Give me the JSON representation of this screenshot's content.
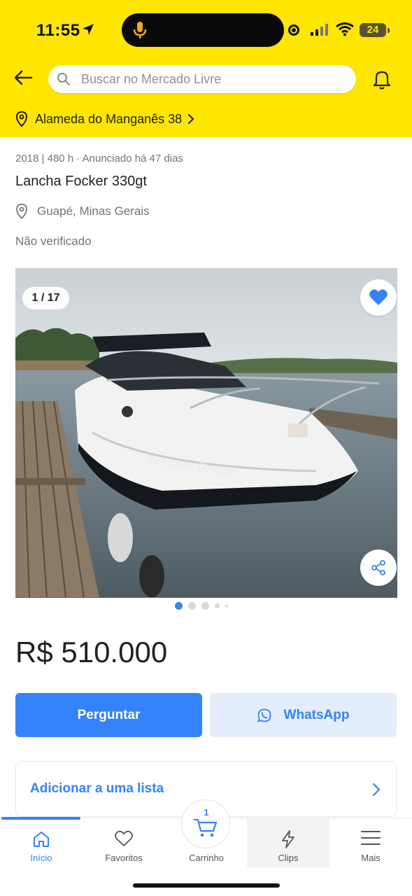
{
  "status_bar": {
    "time": "11:55",
    "battery": "24"
  },
  "header": {
    "search_placeholder": "Buscar no Mercado Livre",
    "address": "Alameda do Manganês 38",
    "accent_color": "#ffe600"
  },
  "listing": {
    "meta": "2018 | 480 h · Anunciado há 47 dias",
    "title": "Lancha Focker 330gt",
    "location": "Guapé, Minas Gerais",
    "verification": "Não verificado",
    "photo_counter": "1 / 17",
    "photo_boat_name": "Summer Dream",
    "price": "R$ 510.000"
  },
  "actions": {
    "ask_label": "Perguntar",
    "whatsapp_label": "WhatsApp",
    "add_to_list_label": "Adicionar a uma lista",
    "primary_color": "#3483fa"
  },
  "bottom_nav": {
    "items": [
      {
        "label": "Início",
        "icon": "home-icon",
        "active": true
      },
      {
        "label": "Favoritos",
        "icon": "heart-icon",
        "active": false
      },
      {
        "label": "Carrinho",
        "icon": "cart-icon",
        "active": false
      },
      {
        "label": "Clips",
        "icon": "lightning-icon",
        "active": false
      },
      {
        "label": "Mais",
        "icon": "menu-icon",
        "active": false
      }
    ],
    "cart_count": "1"
  }
}
